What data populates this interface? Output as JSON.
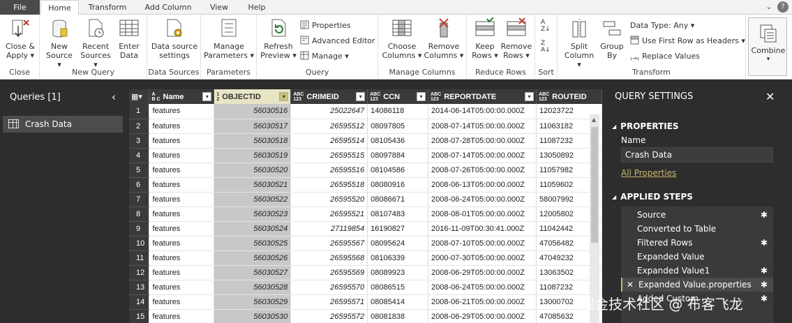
{
  "tabs": {
    "file": "File",
    "home": "Home",
    "transform": "Transform",
    "add_column": "Add Column",
    "view": "View",
    "help": "Help"
  },
  "ribbon": {
    "close": {
      "close_apply": "Close &",
      "apply": "Apply",
      "group": "Close"
    },
    "new_query": {
      "new_source_1": "New",
      "new_source_2": "Source",
      "recent_1": "Recent",
      "recent_2": "Sources",
      "enter_1": "Enter",
      "enter_2": "Data",
      "group": "New Query"
    },
    "data_sources": {
      "settings_1": "Data source",
      "settings_2": "settings",
      "group": "Data Sources"
    },
    "parameters": {
      "manage_1": "Manage",
      "manage_2": "Parameters",
      "group": "Parameters"
    },
    "query": {
      "refresh_1": "Refresh",
      "refresh_2": "Preview",
      "properties": "Properties",
      "advanced_editor": "Advanced Editor",
      "manage": "Manage",
      "group": "Query"
    },
    "manage_columns": {
      "choose_1": "Choose",
      "choose_2": "Columns",
      "remove_1": "Remove",
      "remove_2": "Columns",
      "group": "Manage Columns"
    },
    "reduce_rows": {
      "keep_1": "Keep",
      "keep_2": "Rows",
      "remove_1": "Remove",
      "remove_2": "Rows",
      "group": "Reduce Rows"
    },
    "sort": {
      "group": "Sort"
    },
    "transform": {
      "split_1": "Split",
      "split_2": "Column",
      "group_1": "Group",
      "group_2": "By",
      "data_type": "Data Type: Any",
      "first_row": "Use First Row as Headers",
      "replace": "Replace Values",
      "group": "Transform"
    },
    "combine": {
      "label": "Combine"
    }
  },
  "queries": {
    "title": "Queries [1]",
    "items": [
      {
        "label": "Crash Data"
      }
    ]
  },
  "grid": {
    "columns": [
      {
        "type_top": "A",
        "type_bot": "B C",
        "label": "Name"
      },
      {
        "type_top": "1",
        "type_bot": "2",
        "label": "OBJECTID"
      },
      {
        "type_top": "ABC",
        "type_bot": "123",
        "label": "CRIMEID"
      },
      {
        "type_top": "ABC",
        "type_bot": "123",
        "label": "CCN"
      },
      {
        "type_top": "ABC",
        "type_bot": "123",
        "label": "REPORTDATE"
      },
      {
        "type_top": "ABC",
        "type_bot": "123",
        "label": "ROUTEID"
      }
    ],
    "rows": [
      [
        "1",
        "features",
        "56030516",
        "25022647",
        "14086118",
        "2014-06-14T05:00:00.000Z",
        "12023722"
      ],
      [
        "2",
        "features",
        "56030517",
        "26595512",
        "08097805",
        "2008-07-14T05:00:00.000Z",
        "11063182"
      ],
      [
        "3",
        "features",
        "56030518",
        "26595514",
        "08105436",
        "2008-07-28T05:00:00.000Z",
        "11087232"
      ],
      [
        "4",
        "features",
        "56030519",
        "26595515",
        "08097884",
        "2008-07-14T05:00:00.000Z",
        "13050892"
      ],
      [
        "5",
        "features",
        "56030520",
        "26595516",
        "08104586",
        "2008-07-26T05:00:00.000Z",
        "11057982"
      ],
      [
        "6",
        "features",
        "56030521",
        "26595518",
        "08080916",
        "2008-06-13T05:00:00.000Z",
        "11059602"
      ],
      [
        "7",
        "features",
        "56030522",
        "26595520",
        "08086671",
        "2008-06-24T05:00:00.000Z",
        "58007992"
      ],
      [
        "8",
        "features",
        "56030523",
        "26595521",
        "08107483",
        "2008-08-01T05:00:00.000Z",
        "12005802"
      ],
      [
        "9",
        "features",
        "56030524",
        "27119854",
        "16190827",
        "2016-11-09T00:30:41.000Z",
        "11042442"
      ],
      [
        "10",
        "features",
        "56030525",
        "26595567",
        "08095624",
        "2008-07-10T05:00:00.000Z",
        "47056482"
      ],
      [
        "11",
        "features",
        "56030526",
        "26595568",
        "08106339",
        "2000-07-30T05:00:00.000Z",
        "47049232"
      ],
      [
        "12",
        "features",
        "56030527",
        "26595569",
        "08089923",
        "2008-06-29T05:00:00.000Z",
        "13063502"
      ],
      [
        "13",
        "features",
        "56030528",
        "26595570",
        "08086515",
        "2008-06-24T05:00:00.000Z",
        "11087232"
      ],
      [
        "14",
        "features",
        "56030529",
        "26595571",
        "08085414",
        "2008-06-21T05:00:00.000Z",
        "13000702"
      ],
      [
        "15",
        "features",
        "56030530",
        "26595572",
        "08081838",
        "2008-06-29T05:00:00.000Z",
        "47085632"
      ]
    ]
  },
  "settings": {
    "title": "QUERY SETTINGS",
    "properties": "PROPERTIES",
    "name_label": "Name",
    "name_value": "Crash Data",
    "all_properties": "All Properties",
    "applied_steps": "APPLIED STEPS",
    "steps": [
      {
        "label": "Source",
        "gear": true
      },
      {
        "label": "Converted to Table",
        "gear": false
      },
      {
        "label": "Filtered Rows",
        "gear": true
      },
      {
        "label": "Expanded Value",
        "gear": false
      },
      {
        "label": "Expanded Value1",
        "gear": true
      },
      {
        "label": "Expanded Value.properties",
        "gear": true,
        "selected": true
      },
      {
        "label": "Added Custom",
        "gear": true
      }
    ]
  },
  "watermark": "掘金技术社区 @ 布客飞龙"
}
